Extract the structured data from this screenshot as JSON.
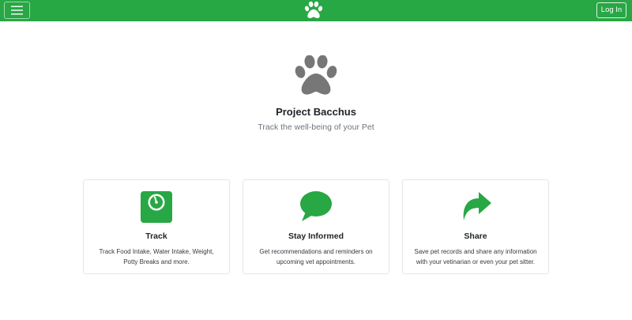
{
  "colors": {
    "accent": "#28a745",
    "paw_gray": "#777777",
    "text_muted": "#6c757d"
  },
  "navbar": {
    "menu_icon": "hamburger-icon",
    "brand_icon": "paw-icon",
    "login_label": "Log In"
  },
  "hero": {
    "icon": "paw-icon",
    "title": "Project Bacchus",
    "subtitle": "Track the well-being of your Pet"
  },
  "features": [
    {
      "icon": "scale-icon",
      "title": "Track",
      "text": "Track Food Intake, Water Intake, Weight, Potty Breaks and more."
    },
    {
      "icon": "chat-bubble-icon",
      "title": "Stay Informed",
      "text": "Get recommendations and reminders on upcoming vet appointments."
    },
    {
      "icon": "share-arrow-icon",
      "title": "Share",
      "text": "Save pet records and share any information with your vetinarian or even your pet sitter."
    }
  ]
}
